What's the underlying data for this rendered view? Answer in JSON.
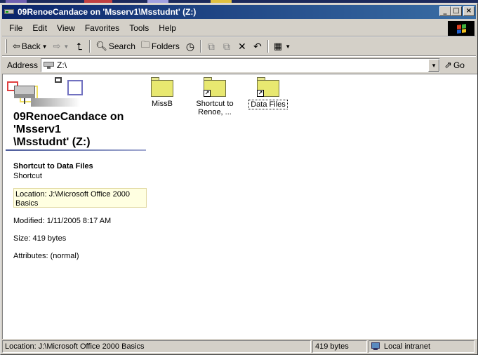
{
  "window": {
    "title": "09RenoeCandace on 'Msserv1\\Msstudnt' (Z:)",
    "caption_buttons": {
      "minimize": "_",
      "maximize": "□",
      "close": "×"
    }
  },
  "menu": [
    "File",
    "Edit",
    "View",
    "Favorites",
    "Tools",
    "Help"
  ],
  "toolbar": {
    "back_label": "Back",
    "search_label": "Search",
    "folders_label": "Folders",
    "icons": [
      "back-arrow-icon",
      "forward-arrow-icon",
      "up-folder-icon",
      "search-icon",
      "folders-icon",
      "history-icon",
      "move-to-icon",
      "copy-to-icon",
      "delete-icon",
      "undo-icon",
      "views-icon"
    ]
  },
  "address": {
    "label": "Address",
    "value": "Z:\\",
    "go_label": "Go"
  },
  "left_pane": {
    "folder_title": "09RenoeCandace on 'Msserv1 \\Msstudnt' (Z:)",
    "title_lines": [
      "09RenoeCandace on",
      "'Msserv1",
      "\\Msstudnt' (Z:)"
    ],
    "selected_name": "Shortcut to Data Files",
    "selected_type": "Shortcut",
    "location": "Location: J:\\Microsoft Office 2000 Basics",
    "modified": "Modified: 1/11/2005 8:17 AM",
    "size": "Size: 419 bytes",
    "attributes": "Attributes: (normal)"
  },
  "files": [
    {
      "label": "MissB",
      "shortcut": false
    },
    {
      "label": "Shortcut to Renoe, ...",
      "label_lines": [
        "Shortcut to",
        "Renoe, ..."
      ],
      "shortcut": true
    },
    {
      "label": "Data Files",
      "shortcut": true,
      "selected": true
    }
  ],
  "status": {
    "location": "Location: J:\\Microsoft Office 2000 Basics",
    "size": "419 bytes",
    "zone": "Local intranet"
  },
  "colors": {
    "title_gradient_start": "#0a246a",
    "title_gradient_end": "#3a6ea5",
    "face": "#d4d0c8",
    "folder": "#e8e870",
    "location_highlight": "#ffffe1"
  }
}
